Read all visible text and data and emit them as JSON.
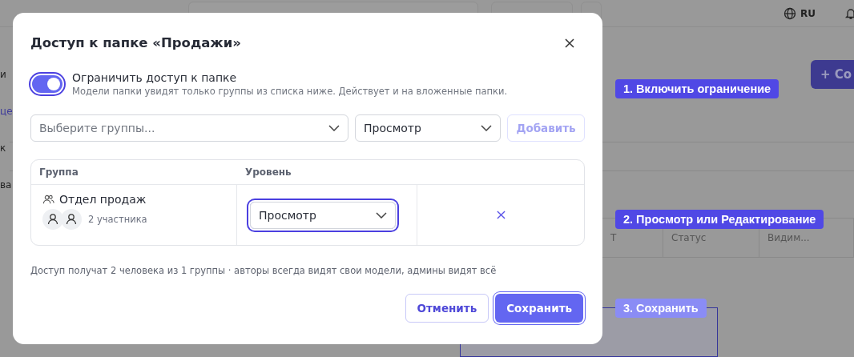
{
  "background": {
    "language": "RU",
    "create_button": "+ Со",
    "left_fragments": [
      "и",
      "це",
      "к",
      "ва"
    ],
    "columns": [
      "Т",
      "Статус",
      "Видим..."
    ]
  },
  "dialog": {
    "title": "Доступ к папке «Продажи»",
    "restrict": {
      "on": true,
      "label": "Ограничить доступ к папке",
      "hint": "Модели папки увидят только группы из списка ниже. Действует и на вложенные папки."
    },
    "group_select": {
      "placeholder": "Выберите группы..."
    },
    "level_select": {
      "value": "Просмотр"
    },
    "add_button": {
      "label": "Добавить",
      "disabled": true
    },
    "table": {
      "columns": [
        "Группа",
        "Уровень"
      ],
      "rows": [
        {
          "group": "Отдел продаж",
          "members": "2 участника",
          "level": "Просмотр",
          "focused": true
        }
      ]
    },
    "footer_note": "Доступ получат 2 человека из 1 группы · авторы всегда видят свои модели, админы видят всё",
    "buttons": [
      {
        "kind": "secondary",
        "label": "Отменить",
        "focused": false
      },
      {
        "kind": "primary",
        "label": "Сохранить",
        "focused": true
      }
    ]
  },
  "callouts": [
    {
      "label": "1. Включить ограничение",
      "active": true
    },
    {
      "label": "2. Просмотр или Редактирование",
      "active": true
    },
    {
      "label": "3. Сохранить",
      "active": false
    }
  ]
}
